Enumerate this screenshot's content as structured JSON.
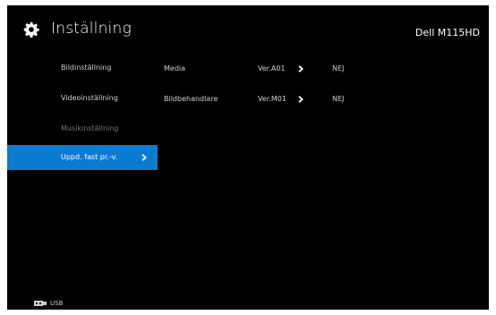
{
  "header": {
    "title": "Inställning",
    "model": "Dell M115HD",
    "icon": "gear-icon"
  },
  "menu": {
    "items": [
      {
        "label": "Bildinställning",
        "state": "normal"
      },
      {
        "label": "Videoinställning",
        "state": "normal"
      },
      {
        "label": "Musikinställning",
        "state": "dim"
      },
      {
        "label": "Uppd. fast pr.-v.",
        "state": "selected"
      }
    ],
    "arrow_icon": "chevron-right-icon",
    "selected_color": "#0b7bd0"
  },
  "firmware": {
    "rows": [
      {
        "name": "Media",
        "version": "Ver.A01",
        "action": "NEJ"
      },
      {
        "name": "Bildbehandlare",
        "version": "Ver.M01",
        "action": "NEJ"
      }
    ]
  },
  "footer": {
    "source_label": "USB",
    "source_icon": "usb-icon"
  }
}
